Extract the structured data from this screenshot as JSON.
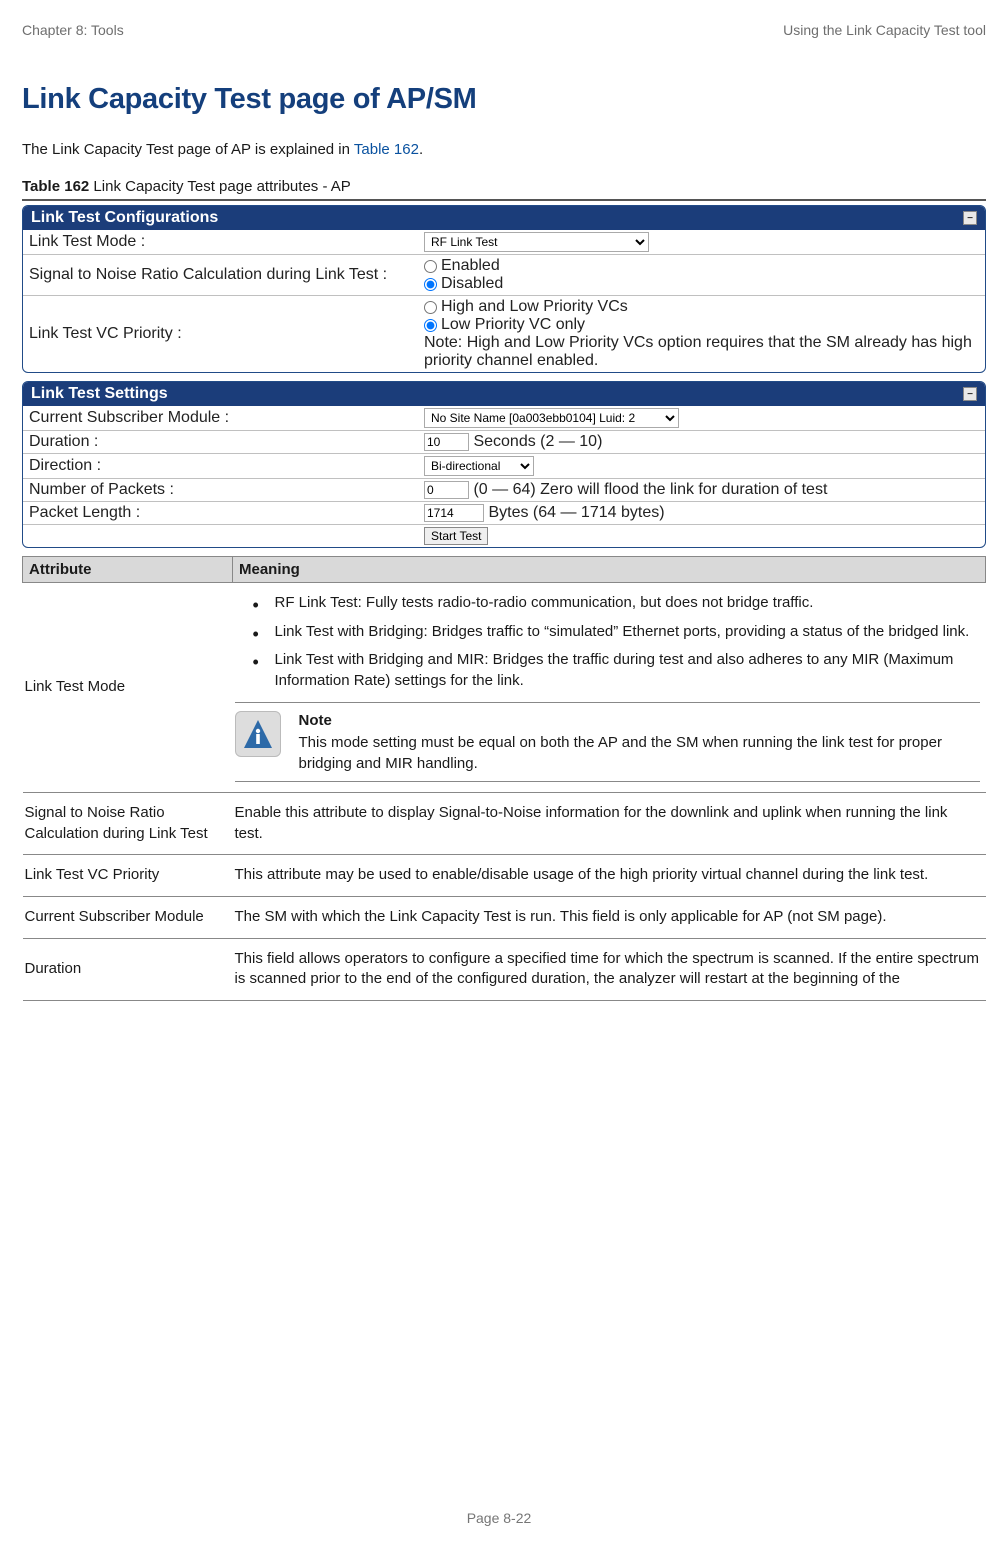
{
  "header": {
    "left": "Chapter 8:  Tools",
    "right": "Using the Link Capacity Test tool"
  },
  "section_title": "Link Capacity Test page of AP/SM",
  "intro": {
    "prefix": "The Link Capacity Test page of AP is explained in ",
    "xref": "Table 162",
    "suffix": "."
  },
  "caption": {
    "label": "Table 162",
    "rest": " Link Capacity Test page attributes - AP"
  },
  "panel_config": {
    "title": "Link Test Configurations",
    "rows": {
      "mode_label": "Link Test Mode :",
      "mode_value": "RF Link Test",
      "snr_label": "Signal to Noise Ratio Calculation during Link Test :",
      "snr_enabled": "Enabled",
      "snr_disabled": "Disabled",
      "vc_label": "Link Test VC Priority :",
      "vc_high_low": "High and Low Priority VCs",
      "vc_low_only": "Low Priority VC only",
      "vc_note": "Note: High and Low Priority VCs option requires that the SM already has high priority channel enabled."
    }
  },
  "panel_settings": {
    "title": "Link Test Settings",
    "rows": {
      "csm_label": "Current Subscriber Module :",
      "csm_value": "No Site Name [0a003ebb0104] Luid: 2",
      "duration_label": "Duration :",
      "duration_value": "10",
      "duration_suffix": " Seconds (2 — 10)",
      "direction_label": "Direction :",
      "direction_value": "Bi-directional",
      "packets_label": "Number of Packets :",
      "packets_value": "0",
      "packets_suffix": " (0 — 64) Zero will flood the link for duration of test",
      "length_label": "Packet Length :",
      "length_value": "1714",
      "length_suffix": " Bytes (64 — 1714 bytes)",
      "start_btn": "Start Test"
    }
  },
  "attr_table": {
    "head_attr": "Attribute",
    "head_meaning": "Meaning",
    "rows": {
      "link_test_mode": {
        "attr": "Link Test Mode",
        "b1": "RF Link Test: Fully tests radio-to-radio communication, but does not bridge traffic.",
        "b2": "Link Test with Bridging: Bridges traffic to “simulated” Ethernet ports, providing a status of the bridged link.",
        "b3": "Link Test with Bridging and MIR: Bridges the traffic during test and also adheres to any MIR (Maximum Information Rate) settings for the link.",
        "note_title": "Note",
        "note_body": "This mode setting must be equal on both the AP and the SM when running the link test for proper bridging and MIR handling."
      },
      "snr": {
        "attr": "Signal to Noise Ratio Calculation during Link Test",
        "meaning": "Enable this attribute to display Signal-to-Noise information for the downlink and uplink when running the link test."
      },
      "vc": {
        "attr": "Link Test VC Priority",
        "meaning": "This attribute may be used to enable/disable usage of the high priority virtual channel during the link test."
      },
      "csm": {
        "attr": "Current Subscriber Module",
        "meaning": "The SM with which the Link Capacity Test is run. This field is only applicable for AP (not SM page)."
      },
      "duration": {
        "attr": "Duration",
        "meaning": "This field allows operators to configure a specified time for which the spectrum is scanned. If the entire spectrum is scanned prior to the end of the configured duration, the analyzer will restart at the beginning of the"
      }
    }
  },
  "footer": "Page 8-22"
}
